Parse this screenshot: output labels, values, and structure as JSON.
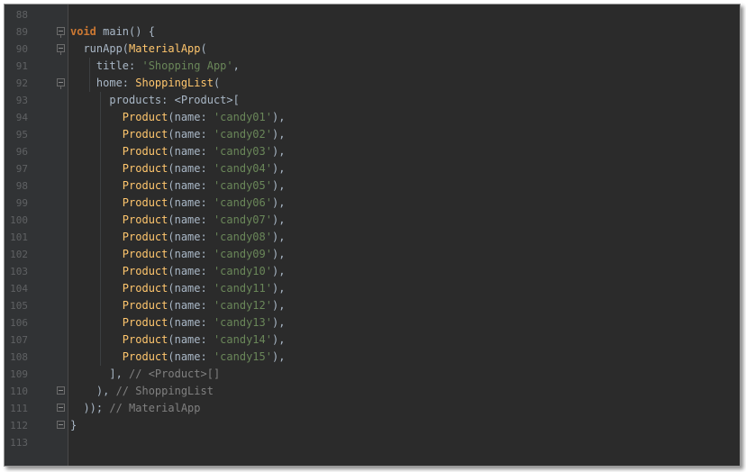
{
  "editor": {
    "lines": [
      {
        "n": "88",
        "fold": "",
        "segments": []
      },
      {
        "n": "89",
        "fold": "open",
        "segments": [
          {
            "t": "void",
            "c": "kw"
          },
          {
            "t": " main() {",
            "c": ""
          }
        ]
      },
      {
        "n": "90",
        "fold": "open",
        "segments": [
          {
            "t": "  runApp(",
            "c": ""
          },
          {
            "t": "MaterialApp",
            "c": "cls"
          },
          {
            "t": "(",
            "c": ""
          }
        ]
      },
      {
        "n": "91",
        "fold": "",
        "segments": [
          {
            "t": "    title: ",
            "c": ""
          },
          {
            "t": "'Shopping App'",
            "c": "str"
          },
          {
            "t": ",",
            "c": ""
          }
        ]
      },
      {
        "n": "92",
        "fold": "open",
        "segments": [
          {
            "t": "    home: ",
            "c": ""
          },
          {
            "t": "ShoppingList",
            "c": "cls"
          },
          {
            "t": "(",
            "c": ""
          }
        ]
      },
      {
        "n": "93",
        "fold": "",
        "segments": [
          {
            "t": "      products: <Product>[",
            "c": ""
          }
        ]
      },
      {
        "n": "94",
        "fold": "",
        "segments": [
          {
            "t": "        ",
            "c": ""
          },
          {
            "t": "Product",
            "c": "cls"
          },
          {
            "t": "(name: ",
            "c": ""
          },
          {
            "t": "'candy01'",
            "c": "str"
          },
          {
            "t": "),",
            "c": ""
          }
        ]
      },
      {
        "n": "95",
        "fold": "",
        "segments": [
          {
            "t": "        ",
            "c": ""
          },
          {
            "t": "Product",
            "c": "cls"
          },
          {
            "t": "(name: ",
            "c": ""
          },
          {
            "t": "'candy02'",
            "c": "str"
          },
          {
            "t": "),",
            "c": ""
          }
        ]
      },
      {
        "n": "96",
        "fold": "",
        "segments": [
          {
            "t": "        ",
            "c": ""
          },
          {
            "t": "Product",
            "c": "cls"
          },
          {
            "t": "(name: ",
            "c": ""
          },
          {
            "t": "'candy03'",
            "c": "str"
          },
          {
            "t": "),",
            "c": ""
          }
        ]
      },
      {
        "n": "97",
        "fold": "",
        "segments": [
          {
            "t": "        ",
            "c": ""
          },
          {
            "t": "Product",
            "c": "cls"
          },
          {
            "t": "(name: ",
            "c": ""
          },
          {
            "t": "'candy04'",
            "c": "str"
          },
          {
            "t": "),",
            "c": ""
          }
        ]
      },
      {
        "n": "98",
        "fold": "",
        "segments": [
          {
            "t": "        ",
            "c": ""
          },
          {
            "t": "Product",
            "c": "cls"
          },
          {
            "t": "(name: ",
            "c": ""
          },
          {
            "t": "'candy05'",
            "c": "str"
          },
          {
            "t": "),",
            "c": ""
          }
        ]
      },
      {
        "n": "99",
        "fold": "",
        "segments": [
          {
            "t": "        ",
            "c": ""
          },
          {
            "t": "Product",
            "c": "cls"
          },
          {
            "t": "(name: ",
            "c": ""
          },
          {
            "t": "'candy06'",
            "c": "str"
          },
          {
            "t": "),",
            "c": ""
          }
        ]
      },
      {
        "n": "100",
        "fold": "",
        "segments": [
          {
            "t": "        ",
            "c": ""
          },
          {
            "t": "Product",
            "c": "cls"
          },
          {
            "t": "(name: ",
            "c": ""
          },
          {
            "t": "'candy07'",
            "c": "str"
          },
          {
            "t": "),",
            "c": ""
          }
        ]
      },
      {
        "n": "101",
        "fold": "",
        "segments": [
          {
            "t": "        ",
            "c": ""
          },
          {
            "t": "Product",
            "c": "cls"
          },
          {
            "t": "(name: ",
            "c": ""
          },
          {
            "t": "'candy08'",
            "c": "str"
          },
          {
            "t": "),",
            "c": ""
          }
        ]
      },
      {
        "n": "102",
        "fold": "",
        "segments": [
          {
            "t": "        ",
            "c": ""
          },
          {
            "t": "Product",
            "c": "cls"
          },
          {
            "t": "(name: ",
            "c": ""
          },
          {
            "t": "'candy09'",
            "c": "str"
          },
          {
            "t": "),",
            "c": ""
          }
        ]
      },
      {
        "n": "103",
        "fold": "",
        "segments": [
          {
            "t": "        ",
            "c": ""
          },
          {
            "t": "Product",
            "c": "cls"
          },
          {
            "t": "(name: ",
            "c": ""
          },
          {
            "t": "'candy10'",
            "c": "str"
          },
          {
            "t": "),",
            "c": ""
          }
        ]
      },
      {
        "n": "104",
        "fold": "",
        "segments": [
          {
            "t": "        ",
            "c": ""
          },
          {
            "t": "Product",
            "c": "cls"
          },
          {
            "t": "(name: ",
            "c": ""
          },
          {
            "t": "'candy11'",
            "c": "str"
          },
          {
            "t": "),",
            "c": ""
          }
        ]
      },
      {
        "n": "105",
        "fold": "",
        "segments": [
          {
            "t": "        ",
            "c": ""
          },
          {
            "t": "Product",
            "c": "cls"
          },
          {
            "t": "(name: ",
            "c": ""
          },
          {
            "t": "'candy12'",
            "c": "str"
          },
          {
            "t": "),",
            "c": ""
          }
        ]
      },
      {
        "n": "106",
        "fold": "",
        "segments": [
          {
            "t": "        ",
            "c": ""
          },
          {
            "t": "Product",
            "c": "cls"
          },
          {
            "t": "(name: ",
            "c": ""
          },
          {
            "t": "'candy13'",
            "c": "str"
          },
          {
            "t": "),",
            "c": ""
          }
        ]
      },
      {
        "n": "107",
        "fold": "",
        "segments": [
          {
            "t": "        ",
            "c": ""
          },
          {
            "t": "Product",
            "c": "cls"
          },
          {
            "t": "(name: ",
            "c": ""
          },
          {
            "t": "'candy14'",
            "c": "str"
          },
          {
            "t": "),",
            "c": ""
          }
        ]
      },
      {
        "n": "108",
        "fold": "",
        "segments": [
          {
            "t": "        ",
            "c": ""
          },
          {
            "t": "Product",
            "c": "cls"
          },
          {
            "t": "(name: ",
            "c": ""
          },
          {
            "t": "'candy15'",
            "c": "str"
          },
          {
            "t": "),",
            "c": ""
          }
        ]
      },
      {
        "n": "109",
        "fold": "",
        "segments": [
          {
            "t": "      ], ",
            "c": ""
          },
          {
            "t": "// <Product>[]",
            "c": "cmt"
          }
        ]
      },
      {
        "n": "110",
        "fold": "close",
        "segments": [
          {
            "t": "    ), ",
            "c": ""
          },
          {
            "t": "// ShoppingList",
            "c": "cmt"
          }
        ]
      },
      {
        "n": "111",
        "fold": "close",
        "segments": [
          {
            "t": "  )); ",
            "c": ""
          },
          {
            "t": "// MaterialApp",
            "c": "cmt"
          }
        ]
      },
      {
        "n": "112",
        "fold": "close",
        "segments": [
          {
            "t": "}",
            "c": ""
          }
        ]
      },
      {
        "n": "113",
        "fold": "",
        "segments": []
      }
    ]
  },
  "colors": {
    "background": "#2b2b2b",
    "gutter": "#313335",
    "keyword": "#cc7832",
    "class": "#ffc66d",
    "string": "#6a8759",
    "comment": "#808080",
    "text": "#a9b7c6"
  }
}
